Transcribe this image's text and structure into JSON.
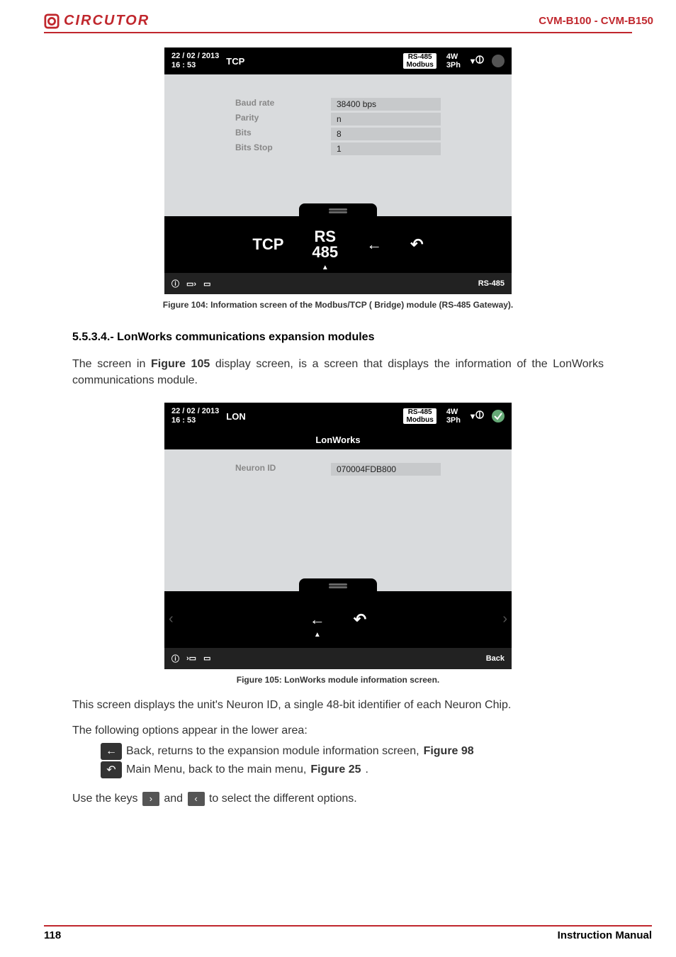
{
  "header": {
    "brand": "CIRCUTOR",
    "docCode": "CVM-B100 - CVM-B150"
  },
  "fig104": {
    "date": "22 / 02 / 2013",
    "time": "16 : 53",
    "mode": "TCP",
    "badgeTop": "RS-485",
    "badgeBottom": "Modbus",
    "wiringTop": "4W",
    "wiringBottom": "3Ph",
    "rows": [
      {
        "label": "Baud rate",
        "value": "38400 bps"
      },
      {
        "label": "Parity",
        "value": "n"
      },
      {
        "label": "Bits",
        "value": "8"
      },
      {
        "label": "Bits Stop",
        "value": "1"
      }
    ],
    "tabs": {
      "t1": "TCP",
      "t2a": "RS",
      "t2b": "485"
    },
    "footerRight": "RS-485",
    "caption": "Figure 104: Information screen of the Modbus/TCP ( Bridge) module (RS-485 Gateway)."
  },
  "sectionHeading": "5.5.3.4.- LonWorks communications expansion modules",
  "para1a": "The screen in ",
  "para1ref": "Figure 105",
  "para1b": " display screen, is a screen that displays the information of the LonWorks communications module.",
  "fig105": {
    "date": "22 / 02 / 2013",
    "time": "16 : 53",
    "mode": "LON",
    "badgeTop": "RS-485",
    "badgeBottom": "Modbus",
    "wiringTop": "4W",
    "wiringBottom": "3Ph",
    "subtitle": "LonWorks",
    "rowLabel": "Neuron ID",
    "rowValue": "070004FDB800",
    "footerRight": "Back",
    "caption": "Figure 105: LonWorks module information screen."
  },
  "para2": "This screen displays the unit's Neuron ID, a single 48-bit identifier of each Neuron Chip.",
  "para3": "The following options appear in the lower area:",
  "opt1a": " Back, returns to the expansion module information screen, ",
  "opt1ref": "Figure 98",
  "opt2a": " Main Menu, back to the main menu, ",
  "opt2ref": "Figure 25",
  "opt2end": ".",
  "para4a": "Use the keys ",
  "para4b": " and ",
  "para4c": " to select the different options.",
  "footer": {
    "page": "118",
    "label": "Instruction Manual"
  }
}
